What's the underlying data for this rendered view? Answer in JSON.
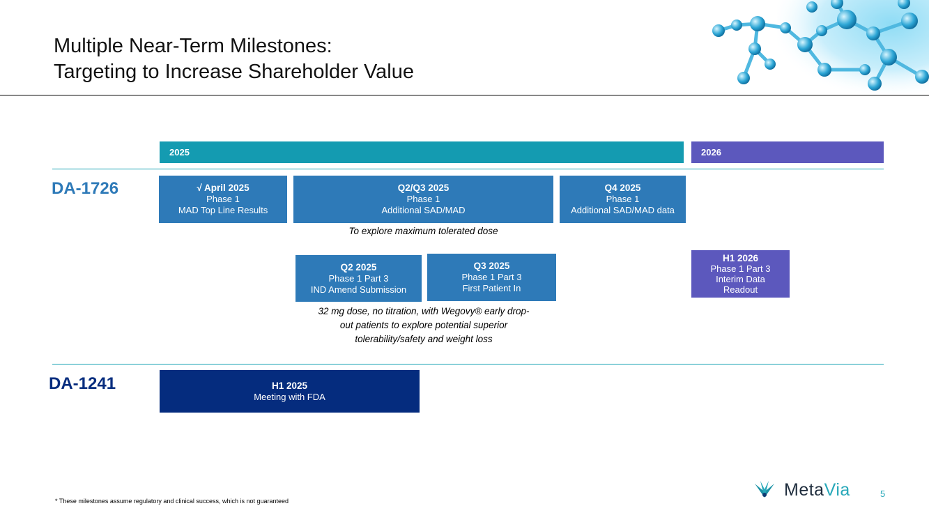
{
  "title": {
    "line1": "Multiple Near-Term Milestones:",
    "line2": "Targeting to Increase Shareholder Value"
  },
  "timeline": {
    "year1": "2025",
    "year2": "2026",
    "year1_color": "#149bb1",
    "year2_color": "#5c58bd"
  },
  "products": {
    "p1": "DA-1726",
    "p2": "DA-1241",
    "color": "#2e7ab8",
    "color2": "#052c7e"
  },
  "milestones": {
    "m1": {
      "head": "√ April 2025",
      "l1": "Phase 1",
      "l2": "MAD Top Line Results"
    },
    "m2": {
      "head": "Q2/Q3 2025",
      "l1": "Phase 1",
      "l2": "Additional SAD/MAD"
    },
    "m3": {
      "head": "Q4 2025",
      "l1": "Phase 1",
      "l2": "Additional SAD/MAD data"
    },
    "m4": {
      "head": "Q2 2025",
      "l1": "Phase 1 Part 3",
      "l2": "IND Amend Submission"
    },
    "m5": {
      "head": "Q3 2025",
      "l1": "Phase 1 Part 3",
      "l2": "First Patient In"
    },
    "m6": {
      "head": "H1 2026",
      "l1": "Phase 1 Part 3",
      "l2": "Interim Data",
      "l3": "Readout"
    },
    "m7": {
      "head": "H1 2025",
      "l1": "Meeting with FDA"
    }
  },
  "notes": {
    "n1": "To explore maximum tolerated dose",
    "n2_l1": "32 mg dose, no titration, with Wegovy® early drop-",
    "n2_l2": "out patients to explore potential superior",
    "n2_l3": "tolerability/safety and weight loss"
  },
  "footnote": "* These milestones assume regulatory and clinical success, which is not guaranteed",
  "logo": {
    "part1": "Meta",
    "part2": "Via"
  },
  "page_number": "5",
  "icons": {
    "molecule": "molecule-graphic",
    "logo_mark": "metavia-leaf-icon"
  }
}
